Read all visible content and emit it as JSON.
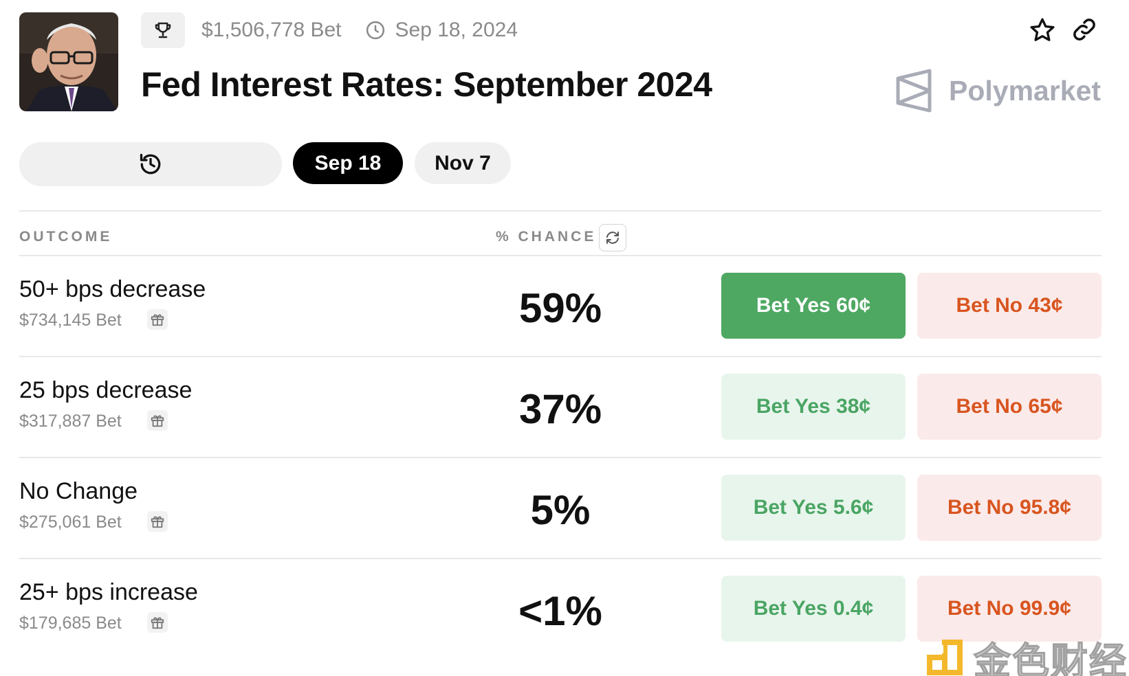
{
  "header": {
    "volume": "$1,506,778 Bet",
    "date": "Sep 18, 2024",
    "title": "Fed Interest Rates: September 2024",
    "brand": "Polymarket"
  },
  "tabs": [
    {
      "label": "Sep 18",
      "active": true
    },
    {
      "label": "Nov 7",
      "active": false
    }
  ],
  "table": {
    "col_outcome": "OUTCOME",
    "col_chance": "% CHANCE",
    "rows": [
      {
        "name": "50+ bps decrease",
        "volume": "$734,145 Bet",
        "chance": "59%",
        "yes": "Bet Yes 60¢",
        "no": "Bet No 43¢"
      },
      {
        "name": "25 bps decrease",
        "volume": "$317,887 Bet",
        "chance": "37%",
        "yes": "Bet Yes 38¢",
        "no": "Bet No 65¢"
      },
      {
        "name": "No Change",
        "volume": "$275,061 Bet",
        "chance": "5%",
        "yes": "Bet Yes 5.6¢",
        "no": "Bet No 95.8¢"
      },
      {
        "name": "25+ bps increase",
        "volume": "$179,685 Bet",
        "chance": "<1%",
        "yes": "Bet Yes 0.4¢",
        "no": "Bet No 99.9¢"
      }
    ]
  },
  "watermark": "金色财经",
  "colors": {
    "yes_selected": "#4ea862",
    "yes_text": "#4aa564",
    "yes_bg": "#e8f5ec",
    "no_text": "#d8551f",
    "no_bg": "#fbeaea",
    "muted": "#8a8a8a"
  },
  "icons": [
    "trophy-icon",
    "clock-icon",
    "star-icon",
    "link-icon",
    "polymarket-logo-icon",
    "history-icon",
    "refresh-icon",
    "gift-icon"
  ]
}
